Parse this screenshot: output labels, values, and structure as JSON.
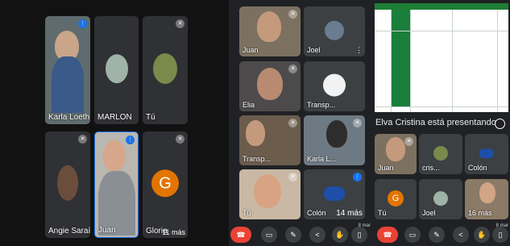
{
  "panel1": {
    "tiles": [
      {
        "name": "Karla Loeth",
        "more": ""
      },
      {
        "name": "MARLON",
        "more": ""
      },
      {
        "name": "Tú",
        "more": ""
      },
      {
        "name": "Angie Saraí",
        "more": ""
      },
      {
        "name": "Juan",
        "more": ""
      },
      {
        "name": "Gloria",
        "more": "11 más"
      }
    ],
    "gloria_letter": "G"
  },
  "panel2": {
    "tiles": [
      {
        "name": "Juan"
      },
      {
        "name": "Joel"
      },
      {
        "name": "Elia"
      },
      {
        "name": "Transp..."
      },
      {
        "name": "Transp..."
      },
      {
        "name": "Karla L..."
      },
      {
        "name": "Tú"
      },
      {
        "name": "Colón"
      }
    ],
    "more_count": "14 más",
    "time": "8 mar"
  },
  "panel3": {
    "presenting_text": "Elva Cristina está presentando",
    "tiles": [
      {
        "name": "Juan"
      },
      {
        "name": "cris..."
      },
      {
        "name": "Colón"
      },
      {
        "name": "Tú"
      },
      {
        "name": "Joel"
      },
      {
        "name": "16 más"
      }
    ],
    "gloria_letter": "G",
    "time": "8 mar"
  },
  "colors": {
    "background": "#202124",
    "hangup": "#ea4335",
    "sheet_green": "#1a7f3a",
    "avatar_orange": "#e37400"
  }
}
